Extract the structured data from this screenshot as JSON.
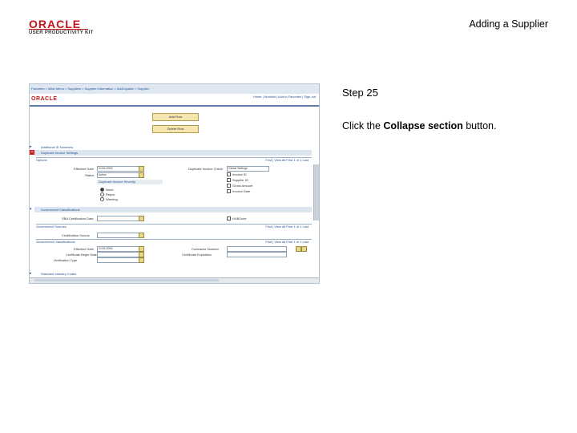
{
  "header": {
    "logo_text": "ORACLE",
    "logo_subtitle": "USER PRODUCTIVITY KIT",
    "doc_title": "Adding a Supplier"
  },
  "step": {
    "label": "Step 25",
    "instruction_prefix": "Click the ",
    "instruction_bold": "Collapse section",
    "instruction_suffix": " button."
  },
  "screenshot": {
    "oracle_logo": "ORACLE",
    "breadcrumb": "Favorites  >  Main Menu  >  Suppliers  >  Supplier Information  >  Add/Update  >  Supplier",
    "nav_links": "Home  |  Worklist  |  Add to Favorites  |  Sign out",
    "buttons": {
      "add_button": "Add Row",
      "delete_button": "Delete Row"
    },
    "sections": {
      "additional_id": "Additional ID Numbers",
      "duplicate_invoice": "Duplicate Invoice Settings",
      "government_classifications": "Government Classifications",
      "standard_industry": "Standard Industry Codes"
    },
    "options": {
      "header": "Options",
      "nav": "Find  |  View All    First  1 of 1  Last",
      "vendor_label": "Effective Date",
      "vendor_value": "01/01/2000",
      "status_label": "Status",
      "status_value": "Active",
      "dup_check_label": "Duplicate Invoice Severity",
      "radio_labels": [
        "None",
        "Reject",
        "Warning"
      ],
      "right_label": "Duplicate Invoice Check",
      "right_select": "Global Settings",
      "checkbox_labels": [
        "Invoice ID",
        "Supplier ID",
        "Gross Amount",
        "Invoice Date"
      ]
    },
    "gov_class": {
      "cert_label": "SBA Certification Date",
      "hubzone_label": "HUBZone"
    },
    "cert_sources": {
      "header": "Government Sources",
      "nav": "Find  |  View All    First  1 of 1  Last",
      "source_label": "Certification Source"
    },
    "gov_certs": {
      "header": "Government Classifications",
      "nav": "Find  |  View All    First  1 of 1  Last",
      "eff_date_label": "Effective Date",
      "eff_date_value": "01/01/2000",
      "cert_begin_label": "Certificate Begin Date",
      "ver_label": "Verification Type",
      "contractor_label": "Contractor Number",
      "cert_exp_label": "Certificate Expiration"
    }
  }
}
